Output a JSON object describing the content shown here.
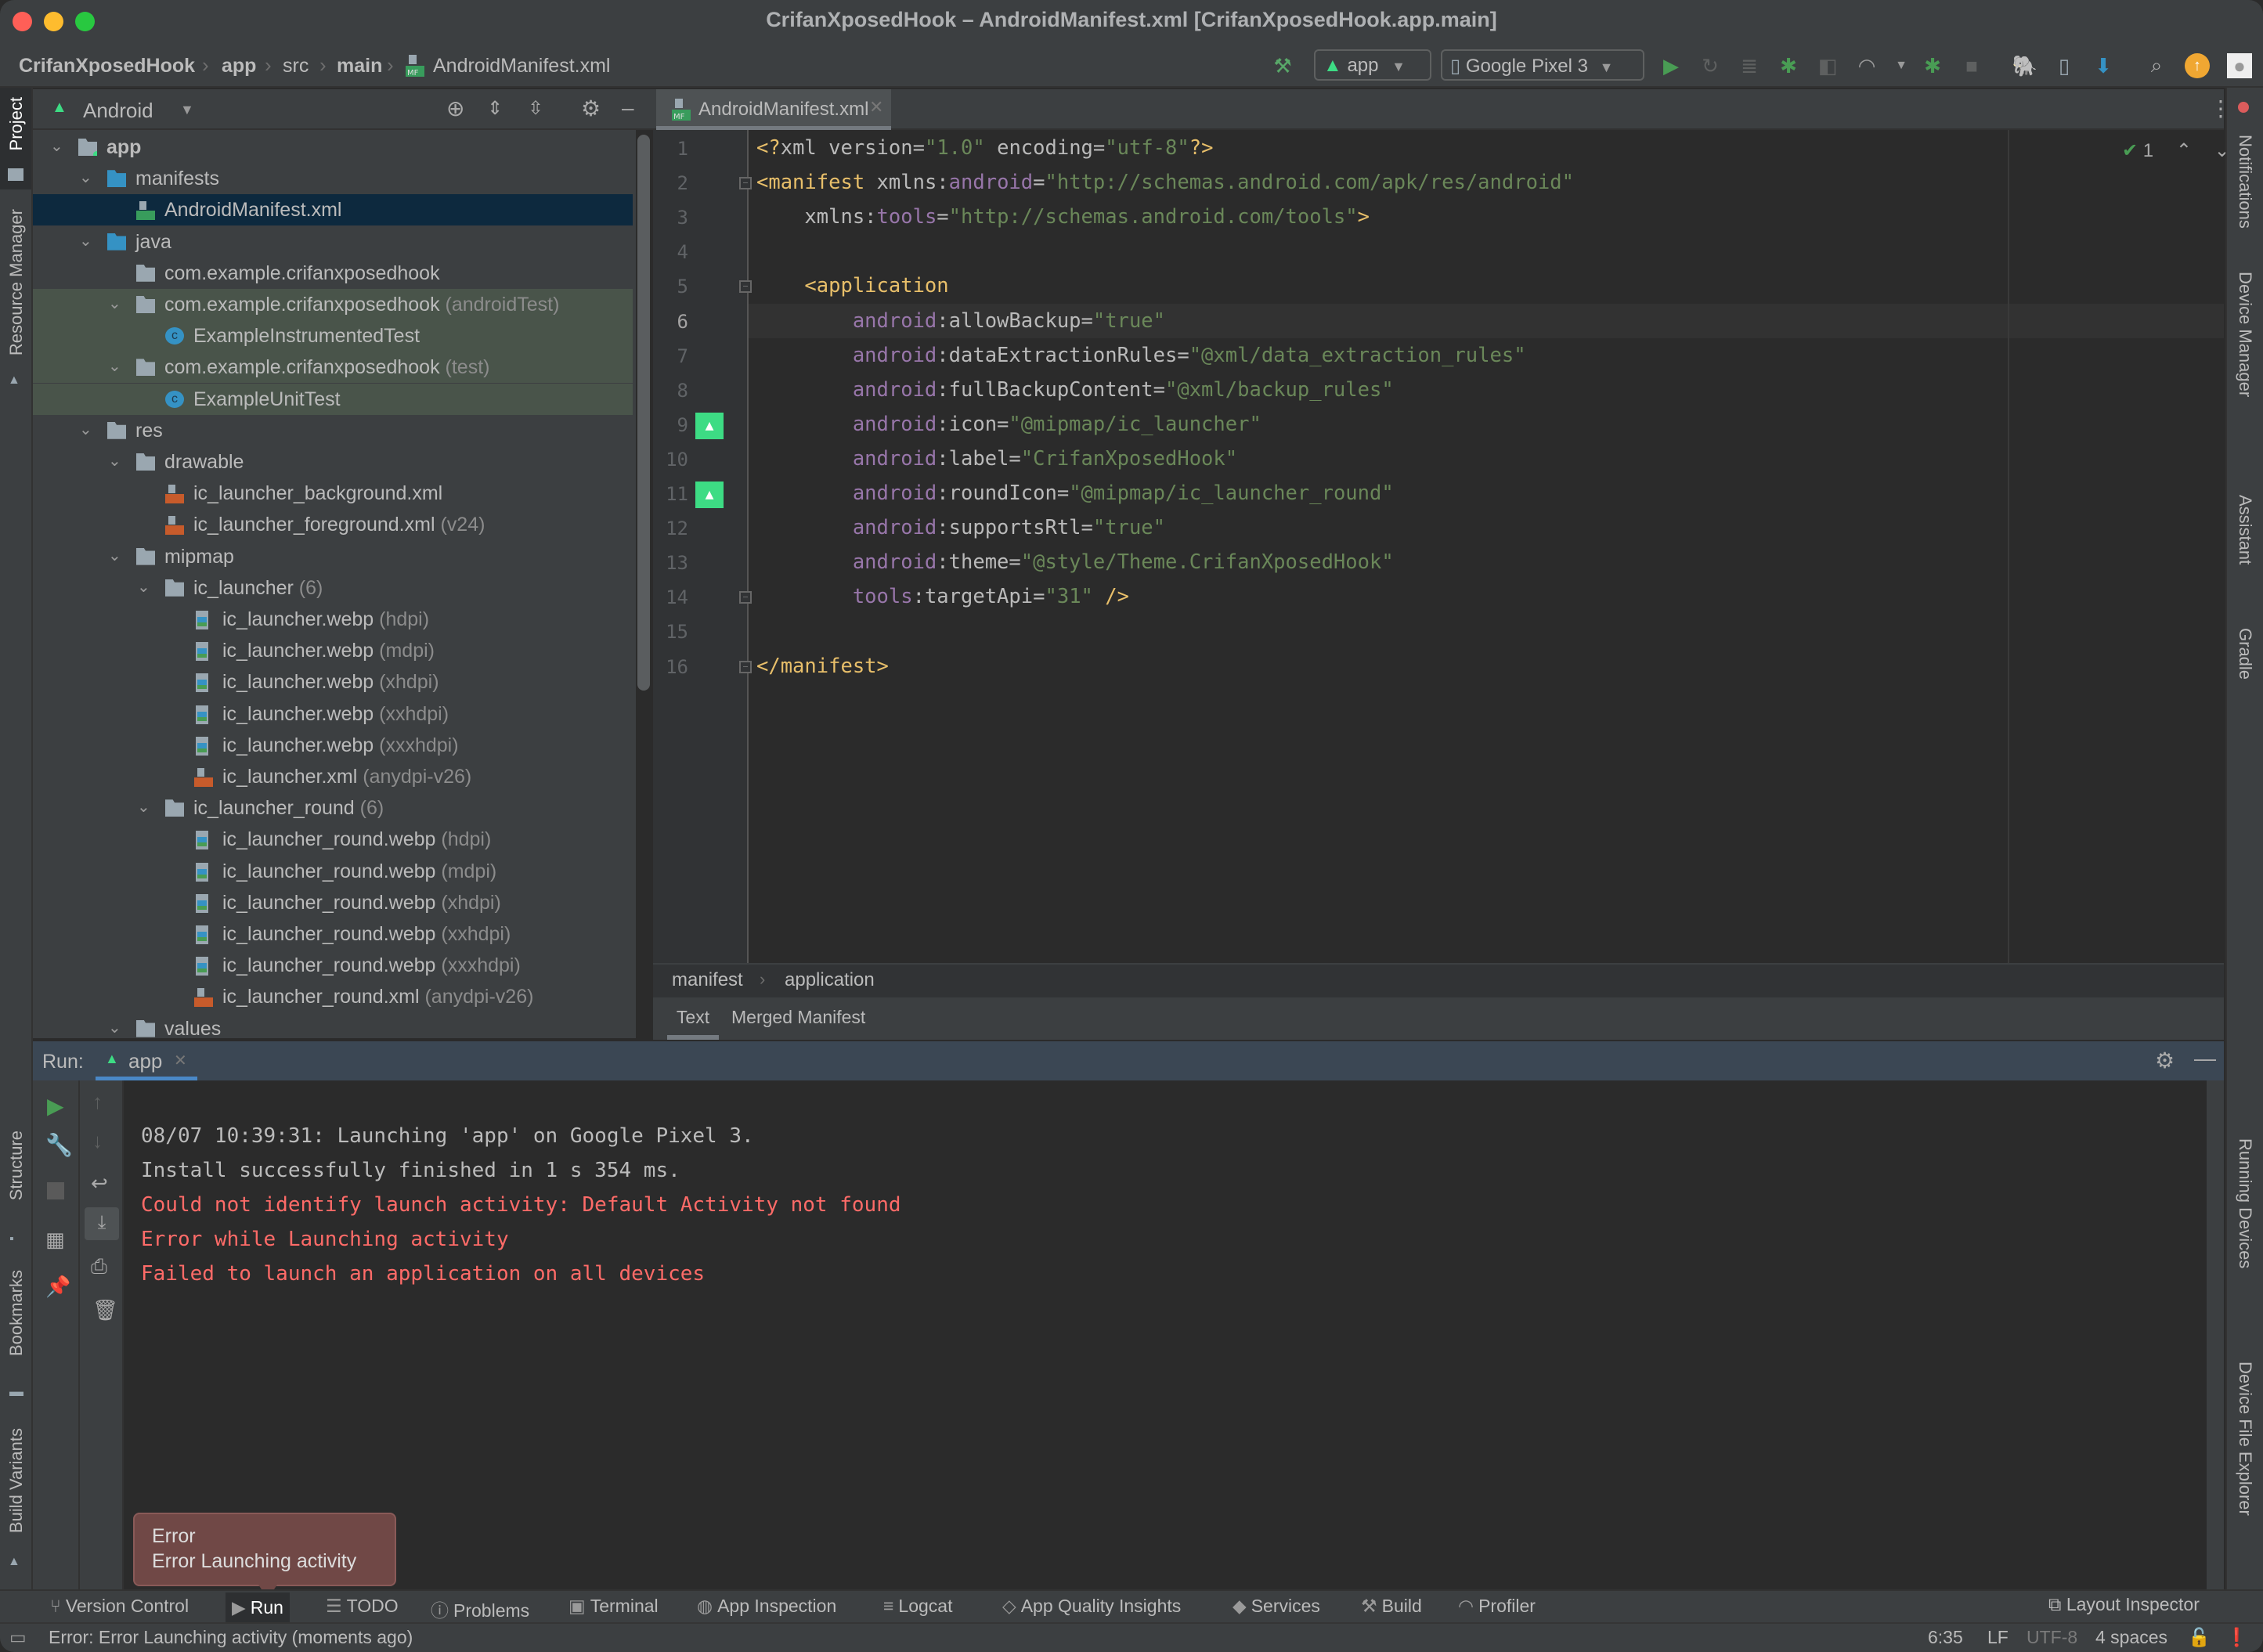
{
  "window": {
    "title": "CrifanXposedHook – AndroidManifest.xml [CrifanXposedHook.app.main]",
    "traffic_colors": {
      "close": "#ff5f57",
      "minimize": "#febc2e",
      "zoom": "#28c840"
    }
  },
  "navbar": {
    "breadcrumbs": [
      "CrifanXposedHook",
      "app",
      "src",
      "main",
      "AndroidManifest.xml"
    ],
    "run_config": "app",
    "device": "Google Pixel 3"
  },
  "toolbar_icons": [
    "make-project-icon",
    "run-icon",
    "apply-changes-icon",
    "apply-code-changes-icon",
    "debug-icon",
    "attach-profiler-icon",
    "profile-icon",
    "attach-debugger-icon",
    "stop-icon",
    "gradle-sync-icon",
    "device-manager-icon",
    "sdk-manager-icon",
    "search-icon",
    "update-icon",
    "account-icon"
  ],
  "left_stripe": {
    "top": [
      {
        "label": "Project",
        "icon": "folder-icon"
      },
      {
        "label": "Resource Manager",
        "icon": "resource-icon"
      }
    ],
    "bottom": [
      {
        "label": "Structure",
        "icon": "structure-icon"
      },
      {
        "label": "Bookmarks",
        "icon": "bookmark-icon"
      },
      {
        "label": "Build Variants",
        "icon": "android-icon"
      }
    ]
  },
  "right_stripe": {
    "top": [
      {
        "label": "Notifications"
      },
      {
        "label": "Device Manager"
      },
      {
        "label": "Assistant"
      },
      {
        "label": "Gradle"
      }
    ],
    "bottom": [
      {
        "label": "Running Devices"
      },
      {
        "label": "Device File Explorer"
      }
    ]
  },
  "project": {
    "view": "Android",
    "tree": [
      {
        "depth": 0,
        "label": "app",
        "hint": "",
        "icon": "module",
        "expanded": true,
        "bold": true
      },
      {
        "depth": 1,
        "label": "manifests",
        "hint": "",
        "icon": "folder-blue",
        "expanded": true
      },
      {
        "depth": 2,
        "label": "AndroidManifest.xml",
        "hint": "",
        "icon": "manifest",
        "selected": true
      },
      {
        "depth": 1,
        "label": "java",
        "hint": "",
        "icon": "folder-blue",
        "expanded": true
      },
      {
        "depth": 2,
        "label": "com.example.crifanxposedhook",
        "hint": "",
        "icon": "package"
      },
      {
        "depth": 2,
        "label": "com.example.crifanxposedhook",
        "hint": "(androidTest)",
        "icon": "package",
        "expanded": true,
        "test": true
      },
      {
        "depth": 3,
        "label": "ExampleInstrumentedTest",
        "hint": "",
        "icon": "class",
        "test": true
      },
      {
        "depth": 2,
        "label": "com.example.crifanxposedhook",
        "hint": "(test)",
        "icon": "package",
        "expanded": true,
        "test": true
      },
      {
        "depth": 3,
        "label": "ExampleUnitTest",
        "hint": "",
        "icon": "class",
        "test": true
      },
      {
        "depth": 1,
        "label": "res",
        "hint": "",
        "icon": "res-folder",
        "expanded": true
      },
      {
        "depth": 2,
        "label": "drawable",
        "hint": "",
        "icon": "package",
        "expanded": true
      },
      {
        "depth": 3,
        "label": "ic_launcher_background.xml",
        "hint": "",
        "icon": "xml"
      },
      {
        "depth": 3,
        "label": "ic_launcher_foreground.xml",
        "hint": "(v24)",
        "icon": "xml"
      },
      {
        "depth": 2,
        "label": "mipmap",
        "hint": "",
        "icon": "package",
        "expanded": true
      },
      {
        "depth": 3,
        "label": "ic_launcher",
        "hint": "(6)",
        "icon": "package",
        "expanded": true
      },
      {
        "depth": 4,
        "label": "ic_launcher.webp",
        "hint": "(hdpi)",
        "icon": "image"
      },
      {
        "depth": 4,
        "label": "ic_launcher.webp",
        "hint": "(mdpi)",
        "icon": "image"
      },
      {
        "depth": 4,
        "label": "ic_launcher.webp",
        "hint": "(xhdpi)",
        "icon": "image"
      },
      {
        "depth": 4,
        "label": "ic_launcher.webp",
        "hint": "(xxhdpi)",
        "icon": "image"
      },
      {
        "depth": 4,
        "label": "ic_launcher.webp",
        "hint": "(xxxhdpi)",
        "icon": "image"
      },
      {
        "depth": 4,
        "label": "ic_launcher.xml",
        "hint": "(anydpi-v26)",
        "icon": "xml"
      },
      {
        "depth": 3,
        "label": "ic_launcher_round",
        "hint": "(6)",
        "icon": "package",
        "expanded": true
      },
      {
        "depth": 4,
        "label": "ic_launcher_round.webp",
        "hint": "(hdpi)",
        "icon": "image"
      },
      {
        "depth": 4,
        "label": "ic_launcher_round.webp",
        "hint": "(mdpi)",
        "icon": "image"
      },
      {
        "depth": 4,
        "label": "ic_launcher_round.webp",
        "hint": "(xhdpi)",
        "icon": "image"
      },
      {
        "depth": 4,
        "label": "ic_launcher_round.webp",
        "hint": "(xxhdpi)",
        "icon": "image"
      },
      {
        "depth": 4,
        "label": "ic_launcher_round.webp",
        "hint": "(xxxhdpi)",
        "icon": "image"
      },
      {
        "depth": 4,
        "label": "ic_launcher_round.xml",
        "hint": "(anydpi-v26)",
        "icon": "xml"
      },
      {
        "depth": 2,
        "label": "values",
        "hint": "",
        "icon": "package",
        "expanded": true
      }
    ]
  },
  "editor": {
    "tab": "AndroidManifest.xml",
    "current_line": 6,
    "inspection_count": "1",
    "lines": [
      [
        [
          "t-tag",
          "<?"
        ],
        [
          "t-attr",
          "xml version"
        ],
        [
          "t-attr",
          "="
        ],
        [
          "t-str",
          "\"1.0\""
        ],
        [
          "t-attr",
          " encoding"
        ],
        [
          "t-attr",
          "="
        ],
        [
          "t-str",
          "\"utf-8\""
        ],
        [
          "t-tag",
          "?>"
        ]
      ],
      [
        [
          "t-tag",
          "<manifest "
        ],
        [
          "t-attr",
          "xmlns:"
        ],
        [
          "t-ns",
          "android"
        ],
        [
          "t-attr",
          "="
        ],
        [
          "t-str",
          "\"http://schemas.android.com/apk/res/android\""
        ]
      ],
      [
        [
          "t-attr",
          "    xmlns:"
        ],
        [
          "t-ns",
          "tools"
        ],
        [
          "t-attr",
          "="
        ],
        [
          "t-str",
          "\"http://schemas.android.com/tools\""
        ],
        [
          "t-tag",
          ">"
        ]
      ],
      [],
      [
        [
          "t-tag",
          "    <application"
        ]
      ],
      [
        [
          "t-ns",
          "        android"
        ],
        [
          "t-attr",
          ":allowBackup="
        ],
        [
          "t-str",
          "\"true\""
        ]
      ],
      [
        [
          "t-ns",
          "        android"
        ],
        [
          "t-attr",
          ":dataExtractionRules="
        ],
        [
          "t-str",
          "\"@xml/data_extraction_rules\""
        ]
      ],
      [
        [
          "t-ns",
          "        android"
        ],
        [
          "t-attr",
          ":fullBackupContent="
        ],
        [
          "t-str",
          "\"@xml/backup_rules\""
        ]
      ],
      [
        [
          "t-ns",
          "        android"
        ],
        [
          "t-attr",
          ":icon="
        ],
        [
          "t-str",
          "\"@mipmap/ic_launcher\""
        ]
      ],
      [
        [
          "t-ns",
          "        android"
        ],
        [
          "t-attr",
          ":label="
        ],
        [
          "t-str",
          "\"CrifanXposedHook\""
        ]
      ],
      [
        [
          "t-ns",
          "        android"
        ],
        [
          "t-attr",
          ":roundIcon="
        ],
        [
          "t-str",
          "\"@mipmap/ic_launcher_round\""
        ]
      ],
      [
        [
          "t-ns",
          "        android"
        ],
        [
          "t-attr",
          ":supportsRtl="
        ],
        [
          "t-str",
          "\"true\""
        ]
      ],
      [
        [
          "t-ns",
          "        android"
        ],
        [
          "t-attr",
          ":theme="
        ],
        [
          "t-str",
          "\"@style/Theme.CrifanXposedHook\""
        ]
      ],
      [
        [
          "t-ns",
          "        tools"
        ],
        [
          "t-attr",
          ":targetApi="
        ],
        [
          "t-str",
          "\"31\""
        ],
        [
          "t-tag",
          " />"
        ]
      ],
      [],
      [
        [
          "t-tag",
          "</manifest>"
        ]
      ]
    ],
    "gutter_icons": [
      9,
      11
    ],
    "fold_markers": [
      2,
      5,
      14,
      16
    ],
    "breadcrumb": [
      "manifest",
      "application"
    ],
    "bottom_tabs": [
      "Text",
      "Merged Manifest"
    ],
    "active_bottom_tab": "Text"
  },
  "run": {
    "label": "Run:",
    "tab": "app",
    "output": [
      {
        "text": "08/07 10:39:31: Launching 'app' on Google Pixel 3.",
        "type": "norm"
      },
      {
        "text": "Install successfully finished in 1 s 354 ms.",
        "type": "norm"
      },
      {
        "text": "Could not identify launch activity: Default Activity not found",
        "type": "err"
      },
      {
        "text": "Error while Launching activity",
        "type": "err"
      },
      {
        "text": "Failed to launch an application on all devices",
        "type": "err"
      }
    ]
  },
  "tooltip": {
    "title": "Error",
    "message": "Error Launching activity"
  },
  "bottom_tools": [
    {
      "label": "Version Control",
      "icon": "vcs-icon"
    },
    {
      "label": "Run",
      "icon": "run-icon",
      "active": true
    },
    {
      "label": "TODO",
      "icon": "todo-icon"
    },
    {
      "label": "Problems",
      "icon": "problems-icon"
    },
    {
      "label": "Terminal",
      "icon": "terminal-icon"
    },
    {
      "label": "App Inspection",
      "icon": "inspection-icon"
    },
    {
      "label": "Logcat",
      "icon": "logcat-icon"
    },
    {
      "label": "App Quality Insights",
      "icon": "diamond-icon"
    },
    {
      "label": "Services",
      "icon": "services-icon"
    },
    {
      "label": "Build",
      "icon": "hammer-icon"
    },
    {
      "label": "Profiler",
      "icon": "profiler-icon"
    }
  ],
  "layout_inspector": "Layout Inspector",
  "status": {
    "message": "Error: Error Launching activity (moments ago)",
    "position": "6:35",
    "line_sep": "LF",
    "encoding": "UTF-8",
    "indent": "4 spaces"
  }
}
